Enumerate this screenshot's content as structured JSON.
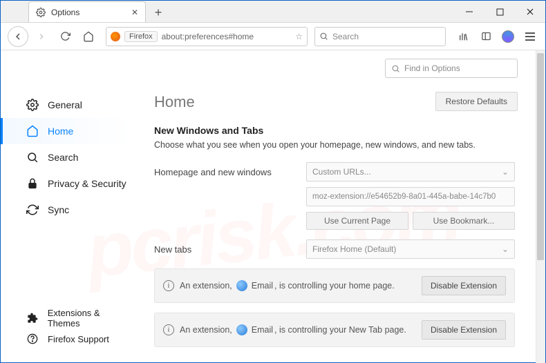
{
  "window": {
    "tab_title": "Options",
    "url_label": "Firefox",
    "url_path": "about:preferences#home",
    "search_placeholder": "Search"
  },
  "find": {
    "placeholder": "Find in Options"
  },
  "sidebar": {
    "items": [
      {
        "label": "General"
      },
      {
        "label": "Home"
      },
      {
        "label": "Search"
      },
      {
        "label": "Privacy & Security"
      },
      {
        "label": "Sync"
      }
    ],
    "footer": [
      {
        "label": "Extensions & Themes"
      },
      {
        "label": "Firefox Support"
      }
    ]
  },
  "main": {
    "title": "Home",
    "restore_label": "Restore Defaults",
    "section_title": "New Windows and Tabs",
    "section_desc": "Choose what you see when you open your homepage, new windows, and new tabs.",
    "homepage_label": "Homepage and new windows",
    "homepage_dropdown": "Custom URLs...",
    "homepage_url": "moz-extension://e54652b9-8a01-445a-babe-14c7b0",
    "use_current_label": "Use Current Page",
    "use_bookmark_label": "Use Bookmark...",
    "newtabs_label": "New tabs",
    "newtabs_dropdown": "Firefox Home (Default)",
    "notice1_pre": "An extension,",
    "notice1_ext": "Email",
    "notice1_post": ", is controlling your home page.",
    "notice2_pre": "An extension,",
    "notice2_ext": "Email",
    "notice2_post": ", is controlling your New Tab page.",
    "disable_label": "Disable Extension"
  }
}
